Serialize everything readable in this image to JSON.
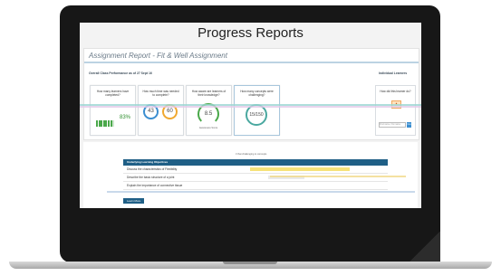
{
  "screen": {
    "title": "Progress Reports",
    "report_title": "Assignment Report - Fit & Well Assignment",
    "overall_heading": "Overall Class Performance as of  27 Sept 16",
    "individual_heading": "Individual Learners"
  },
  "cards": [
    {
      "question": "How many learners have completed?",
      "value": "83%"
    },
    {
      "question": "How much time was needed to complete?",
      "value_a": "43",
      "value_b": "60"
    },
    {
      "question": "How aware are learners of their knowledge?",
      "value": "8.5",
      "caption": "Awareness Score"
    },
    {
      "question": "How many concepts were challenging?",
      "value": "15/150"
    }
  ],
  "individual": {
    "question": "How did this learner do?",
    "search_placeholder": "Find name, first name",
    "go_label": "Go"
  },
  "lower": {
    "hint": "3 that challenging to concepts",
    "table_header": "Underlying Learning Objectives",
    "rows": [
      "Discuss the characteristics of Flexibility",
      "Describe the basic structure of a joint",
      "Explain the importance of connective tissue"
    ],
    "learn_more": "Learn More"
  }
}
